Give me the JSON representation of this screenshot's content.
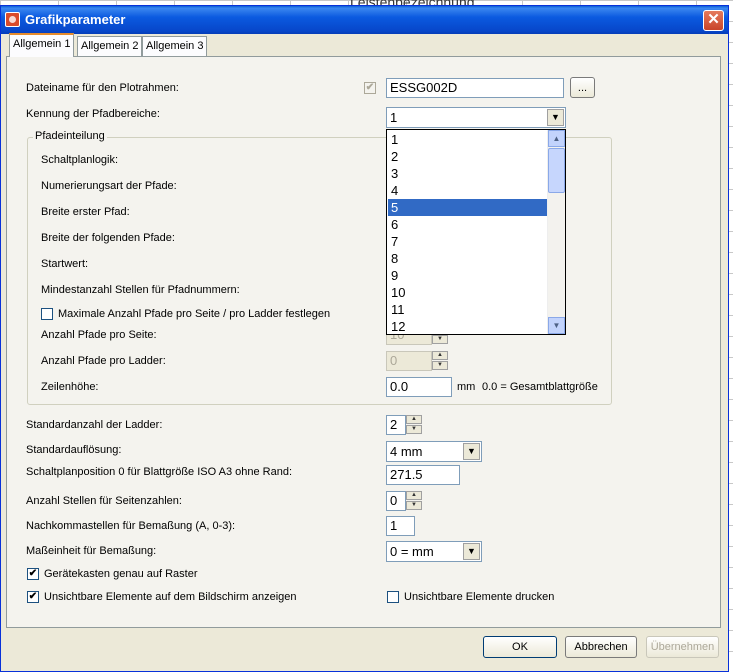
{
  "window": {
    "title": "Grafikparameter",
    "close_label": "✕"
  },
  "background_text": "Leistenbezeichnung",
  "tabs": [
    {
      "label": "Allgemein 1",
      "active": true
    },
    {
      "label": "Allgemein 2",
      "active": false
    },
    {
      "label": "Allgemein 3",
      "active": false
    }
  ],
  "fields": {
    "dateiname_label": "Dateiname für den Plotrahmen:",
    "dateiname_value": "ESSG002D",
    "browse_label": "...",
    "kennung_label": "Kennung der Pfadbereiche:",
    "kennung_value": "1",
    "group_title": "Pfadeinteilung",
    "schaltplanlogik_label": "Schaltplanlogik:",
    "numerierungsart_label": "Numerierungsart der Pfade:",
    "breite_erster_label": "Breite erster Pfad:",
    "breite_folgende_label": "Breite der folgenden Pfade:",
    "startwert_label": "Startwert:",
    "mindestanzahl_label": "Mindestanzahl Stellen für Pfadnummern:",
    "maximale_label": "Maximale Anzahl Pfade pro Seite / pro Ladder festlegen",
    "pfade_seite_label": "Anzahl Pfade pro Seite:",
    "pfade_seite_value": "10",
    "pfade_ladder_label": "Anzahl Pfade pro Ladder:",
    "pfade_ladder_value": "0",
    "zeilenhoehe_label": "Zeilenhöhe:",
    "zeilenhoehe_value": "0.0",
    "zeilenhoehe_unit": "mm",
    "zeilenhoehe_hint": "0.0 = Gesamtblattgröße",
    "standardanzahl_label": "Standardanzahl der Ladder:",
    "standardanzahl_value": "2",
    "standardaufloesung_label": "Standardauflösung:",
    "standardaufloesung_value": "4 mm",
    "schaltplanposition_label": "Schaltplanposition 0 für Blattgröße ISO A3 ohne Rand:",
    "schaltplanposition_value": "271.5",
    "stellen_seitenzahlen_label": "Anzahl Stellen für Seitenzahlen:",
    "stellen_seitenzahlen_value": "0",
    "nachkomma_label": "Nachkommastellen für Bemaßung (A, 0-3):",
    "nachkomma_value": "1",
    "masseinheit_label": "Maßeinheit für Bemaßung:",
    "masseinheit_value": "0 = mm",
    "geraetekasten_label": "Gerätekasten genau auf Raster",
    "unsichtbare_anzeigen_label": "Unsichtbare Elemente auf dem Bildschirm anzeigen",
    "unsichtbare_drucken_label": "Unsichtbare Elemente drucken",
    "check_mark": "✔"
  },
  "dropdown": {
    "items": [
      "1",
      "2",
      "3",
      "4",
      "5",
      "6",
      "7",
      "8",
      "9",
      "10",
      "11",
      "12"
    ],
    "selected_index": 4
  },
  "buttons": {
    "ok": "OK",
    "abbrechen": "Abbrechen",
    "uebernehmen": "Übernehmen"
  },
  "icons": {
    "spin_up": "▲",
    "spin_down": "▼",
    "combo_arrow": "▼",
    "scroll_up": "▲",
    "scroll_down": "▼"
  }
}
